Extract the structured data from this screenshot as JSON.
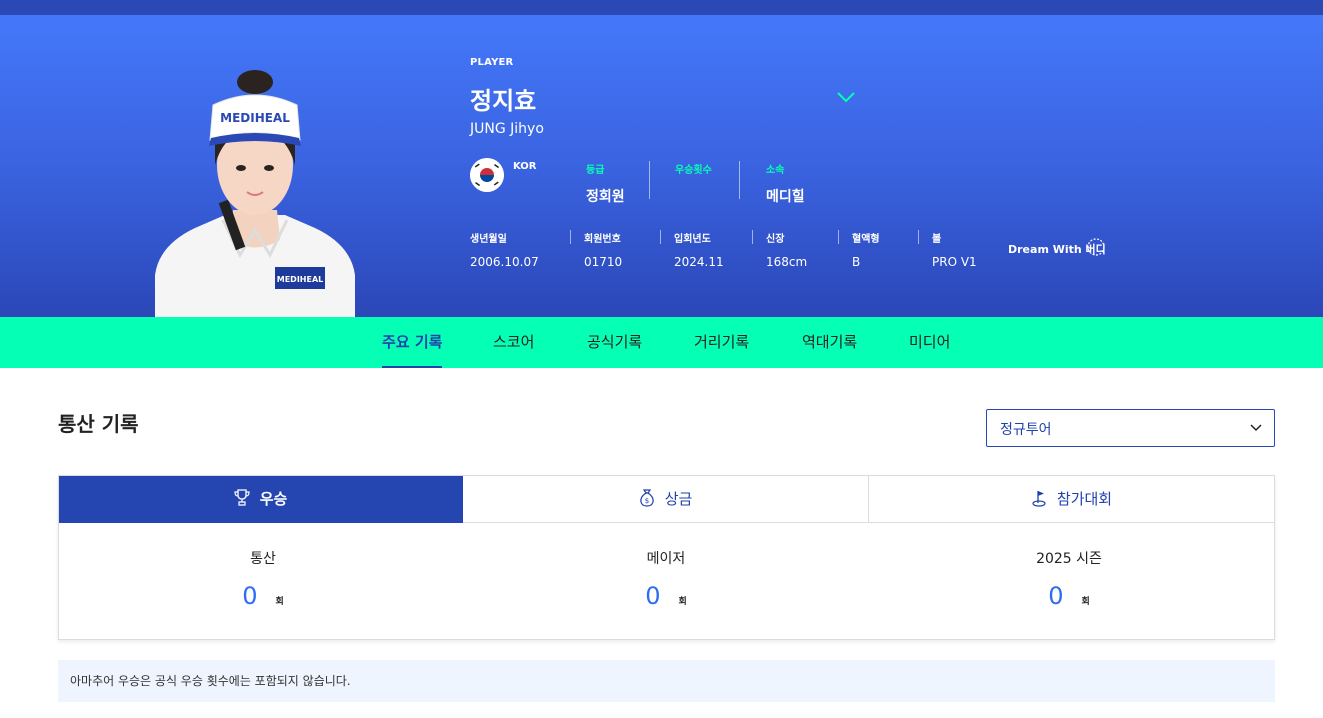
{
  "hero": {
    "label": "PLAYER",
    "name": "정지효",
    "name_eng": "JUNG Jihyo",
    "country": "KOR",
    "info": [
      {
        "key": "등급",
        "value": "정회원"
      },
      {
        "key": "우승횟수",
        "value": ""
      },
      {
        "key": "소속",
        "value": "메디힐"
      }
    ],
    "meta": [
      {
        "key": "생년월일",
        "value": "2006.10.07"
      },
      {
        "key": "회원번호",
        "value": "01710"
      },
      {
        "key": "입회년도",
        "value": "2024.11"
      },
      {
        "key": "신장",
        "value": "168cm"
      },
      {
        "key": "혈액형",
        "value": "B"
      },
      {
        "key": "볼",
        "value": "PRO V1"
      }
    ],
    "sponsor_logo": "Dream With 버디",
    "visor_text": "MEDIHEAL",
    "shirt_text": "MEDIHEAL"
  },
  "tabs": [
    "주요 기록",
    "스코어",
    "공식기록",
    "거리기록",
    "역대기록",
    "미디어"
  ],
  "section": {
    "title": "통산 기록",
    "select_value": "정규투어"
  },
  "card": {
    "tabs": [
      {
        "label": "우승",
        "icon": "trophy-icon"
      },
      {
        "label": "상금",
        "icon": "money-bag-icon"
      },
      {
        "label": "참가대회",
        "icon": "golf-flag-icon"
      }
    ],
    "stats": [
      {
        "label": "통산",
        "value": "0",
        "unit": "회"
      },
      {
        "label": "메이저",
        "value": "0",
        "unit": "회"
      },
      {
        "label": "2025 시즌",
        "value": "0",
        "unit": "회"
      }
    ]
  },
  "notice": "아마추어 우승은 공식 우승 횟수에는 포함되지 않습니다.",
  "colors": {
    "hero_top": "#4478fa",
    "hero_bottom": "#2b47b8",
    "tab_bar": "#05ffb4",
    "accent": "#2142ad",
    "number": "#2d6cf5"
  }
}
